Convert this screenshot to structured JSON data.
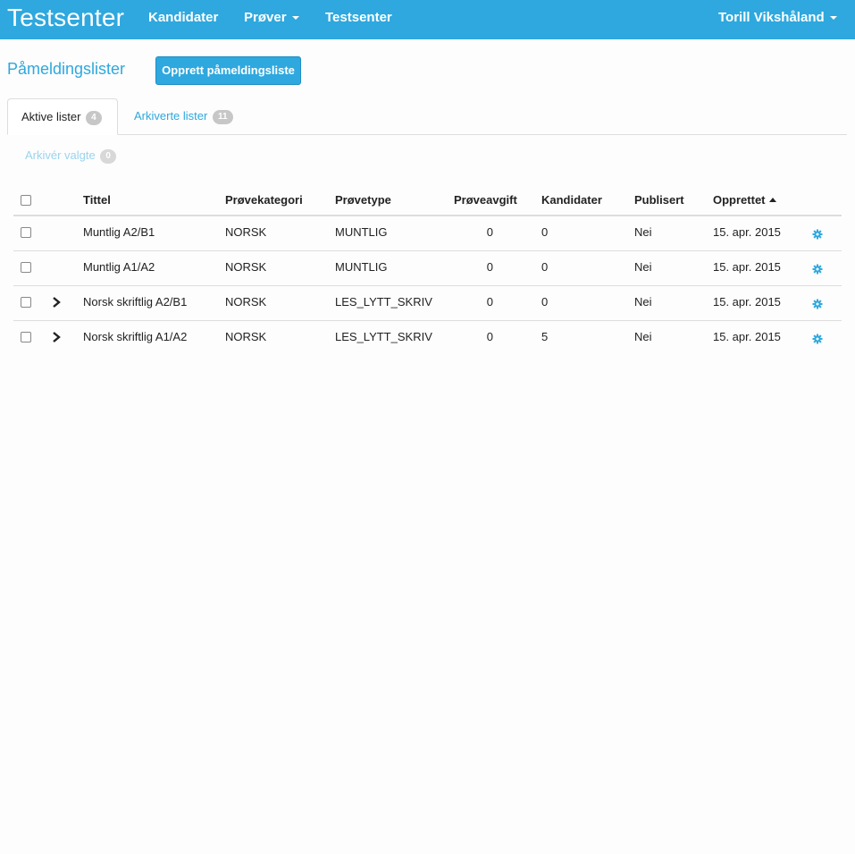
{
  "navbar": {
    "brand": "Testsenter",
    "links": [
      "Kandidater",
      "Prøver",
      "Testsenter"
    ],
    "user": "Torill Vikshåland"
  },
  "page": {
    "title": "Påmeldingslister",
    "create_button": "Opprett påmeldingsliste"
  },
  "tabs": [
    {
      "label": "Aktive lister",
      "count": "4"
    },
    {
      "label": "Arkiverte lister",
      "count": "11"
    }
  ],
  "archive": {
    "label": "Arkivér valgte",
    "count": "0"
  },
  "table": {
    "columns": [
      "Tittel",
      "Prøvekategori",
      "Prøvetype",
      "Prøveavgift",
      "Kandidater",
      "Publisert",
      "Opprettet"
    ],
    "rows": [
      {
        "tittel": "Muntlig A2/B1",
        "kategori": "NORSK",
        "type": "MUNTLIG",
        "avgift": "0",
        "kandidater": "0",
        "publisert": "Nei",
        "opprettet": "15. apr. 2015",
        "expandable": false
      },
      {
        "tittel": "Muntlig A1/A2",
        "kategori": "NORSK",
        "type": "MUNTLIG",
        "avgift": "0",
        "kandidater": "0",
        "publisert": "Nei",
        "opprettet": "15. apr. 2015",
        "expandable": false
      },
      {
        "tittel": "Norsk skriftlig A2/B1",
        "kategori": "NORSK",
        "type": "LES_LYTT_SKRIV",
        "avgift": "0",
        "kandidater": "0",
        "publisert": "Nei",
        "opprettet": "15. apr. 2015",
        "expandable": true
      },
      {
        "tittel": "Norsk skriftlig A1/A2",
        "kategori": "NORSK",
        "type": "LES_LYTT_SKRIV",
        "avgift": "0",
        "kandidater": "5",
        "publisert": "Nei",
        "opprettet": "15. apr. 2015",
        "expandable": true
      }
    ]
  },
  "colors": {
    "accent": "#2ea8de"
  }
}
